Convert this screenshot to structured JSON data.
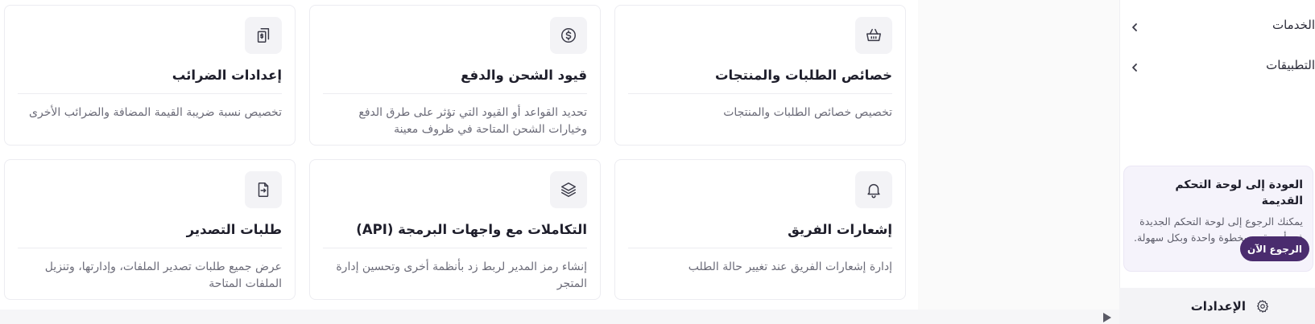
{
  "sidebar": {
    "items": [
      {
        "label": "الخدمات",
        "icon": "chevron-left-icon"
      },
      {
        "label": "التطبيقات",
        "icon": "chevron-left-icon"
      }
    ],
    "promo": {
      "title": "العودة إلى لوحة التحكم القديمة",
      "text": "يمكنك الرجوع إلى لوحة التحكم الجديدة في أي وقت، بخطوة واحدة وبكل سهولة.",
      "button": "الرجوع الآن"
    },
    "settings": {
      "label": "الإعدادات",
      "icon": "gear-icon"
    }
  },
  "cards": [
    {
      "title": "خصائص الطلبات والمنتجات",
      "desc": "تخصيص خصائص الطلبات والمنتجات",
      "icon": "basket-icon"
    },
    {
      "title": "قيود الشحن والدفع",
      "desc": "تحديد القواعد أو القيود التي تؤثر على طرق الدفع وخيارات الشحن المتاحة في ظروف معينة",
      "icon": "dollar-coin-icon"
    },
    {
      "title": "إعدادات الضرائب",
      "desc": "تخصيص نسبة ضريبة القيمة المضافة والضرائب الأخرى",
      "icon": "tax-invoice-icon"
    },
    {
      "title": "إشعارات الفريق",
      "desc": "إدارة إشعارات الفريق عند تغيير حالة الطلب",
      "icon": "bell-icon"
    },
    {
      "title": "التكاملات مع واجهات البرمجة (API)",
      "desc": "إنشاء رمز المدير لربط زد بأنظمة أخرى وتحسين إدارة المتجر",
      "icon": "layers-icon"
    },
    {
      "title": "طلبات التصدير",
      "desc": "عرض جميع طلبات تصدير الملفات، وإدارتها، وتنزيل الملفات المتاحة",
      "icon": "file-export-icon"
    }
  ],
  "colors": {
    "accent": "#4a2c6e",
    "card_border": "#ececf1",
    "icon_bg": "#f3f3f6",
    "promo_bg": "#f5f3fb"
  }
}
